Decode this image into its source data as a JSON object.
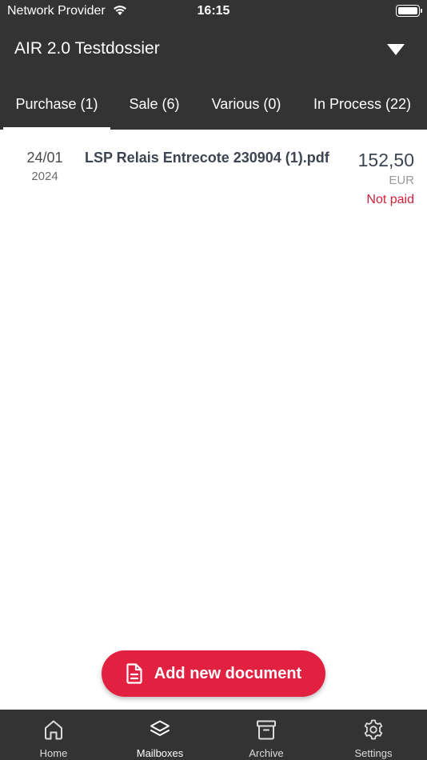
{
  "status_bar": {
    "carrier": "Network Provider",
    "time": "16:15"
  },
  "header": {
    "title": "AIR 2.0 Testdossier"
  },
  "tabs": [
    {
      "label": "Purchase (1)",
      "active": true
    },
    {
      "label": "Sale (6)",
      "active": false
    },
    {
      "label": "Various (0)",
      "active": false
    },
    {
      "label": "In Process (22)",
      "active": false
    }
  ],
  "documents": [
    {
      "day_month": "24/01",
      "year": "2024",
      "name": "LSP Relais Entrecote 230904 (1).pdf",
      "amount": "152,50",
      "currency": "EUR",
      "status": "Not paid"
    }
  ],
  "add_button": {
    "label": "Add new document"
  },
  "tabbar": [
    {
      "label": "Home",
      "icon": "home-icon"
    },
    {
      "label": "Mailboxes",
      "icon": "layers-icon",
      "active": true
    },
    {
      "label": "Archive",
      "icon": "archive-icon"
    },
    {
      "label": "Settings",
      "icon": "gear-icon"
    }
  ],
  "colors": {
    "header_bg": "#333333",
    "accent": "#e2203f",
    "status_red": "#d0213a"
  }
}
